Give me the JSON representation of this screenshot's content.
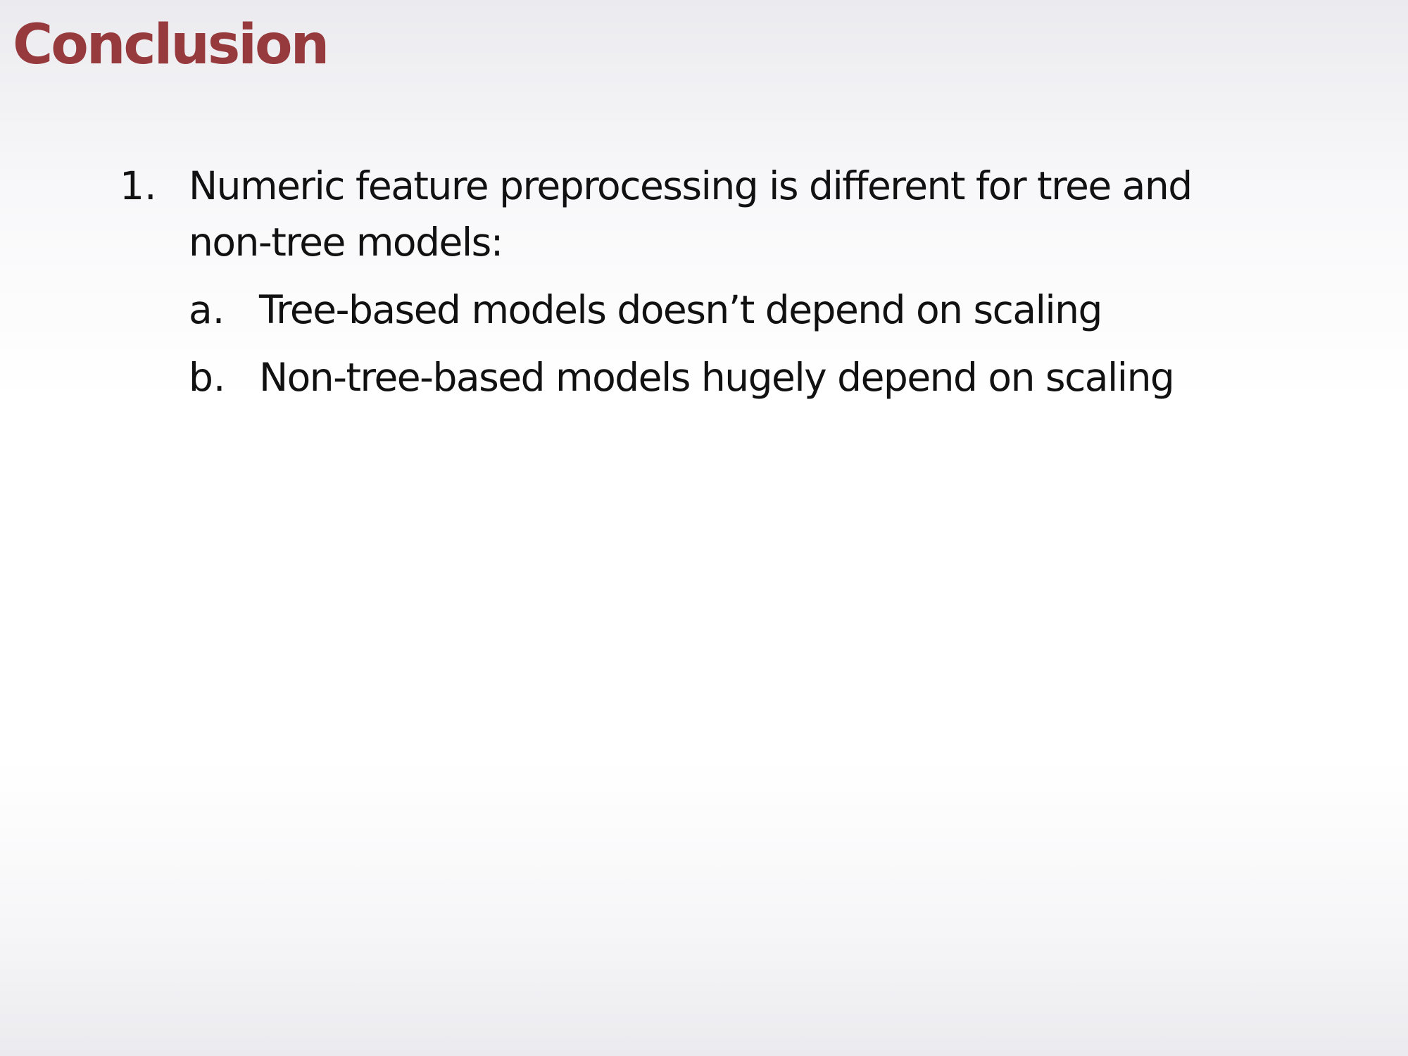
{
  "slide": {
    "title": "Conclusion",
    "items": [
      {
        "marker": "1.",
        "line1": "Numeric feature preprocessing is different for tree and",
        "line2": "non-tree models:",
        "subitems": [
          {
            "marker": "a.",
            "text": "Tree-based models doesn’t depend on scaling"
          },
          {
            "marker": "b.",
            "text": "Non-tree-based models hugely depend on scaling"
          }
        ]
      }
    ]
  },
  "colors": {
    "title": "#963a3e",
    "body_text": "#111111",
    "background": "#ffffff"
  }
}
